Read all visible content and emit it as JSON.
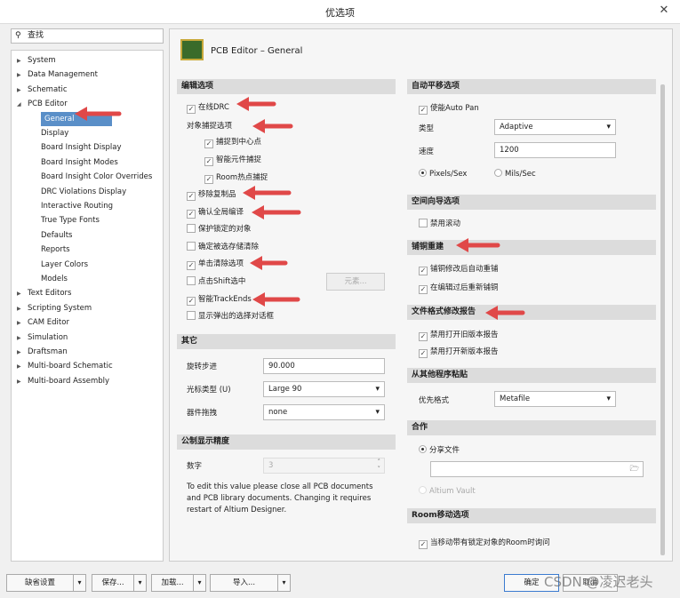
{
  "window": {
    "title": "优选项",
    "close": "✕"
  },
  "search": {
    "placeholder": "查找",
    "icon": "search-icon"
  },
  "tree": [
    {
      "label": "System"
    },
    {
      "label": "Data Management"
    },
    {
      "label": "Schematic"
    },
    {
      "label": "PCB Editor"
    },
    {
      "label": "General"
    },
    {
      "label": "Display"
    },
    {
      "label": "Board Insight Display"
    },
    {
      "label": "Board Insight Modes"
    },
    {
      "label": "Board Insight Color Overrides"
    },
    {
      "label": "DRC Violations Display"
    },
    {
      "label": "Interactive Routing"
    },
    {
      "label": "True Type Fonts"
    },
    {
      "label": "Defaults"
    },
    {
      "label": "Reports"
    },
    {
      "label": "Layer Colors"
    },
    {
      "label": "Models"
    },
    {
      "label": "Text Editors"
    },
    {
      "label": "Scripting System"
    },
    {
      "label": "CAM Editor"
    },
    {
      "label": "Simulation"
    },
    {
      "label": "Draftsman"
    },
    {
      "label": "Multi-board Schematic"
    },
    {
      "label": "Multi-board Assembly"
    }
  ],
  "page_title": "PCB Editor – General",
  "edit": {
    "header": "编辑选项",
    "online_drc": "在线DRC",
    "snap_header": "对象捕捉选项",
    "snap_center": "捕捉到中心点",
    "smart_snap": "智能元件捕捉",
    "room_snap": "Room热点捕捉",
    "remove_dup": "移除复制品",
    "confirm_global": "确认全局编译",
    "protect_locked": "保护锁定的对象",
    "confirm_clear": "确定被选存储清除",
    "click_clear": "单击清除选项",
    "shift_select": "点击Shift选中",
    "elements_btn": "元素...",
    "smart_trackends": "智能TrackEnds",
    "show_popup": "显示弹出的选择对话框"
  },
  "other": {
    "header": "其它",
    "rotation_label": "旋转步进",
    "rotation": "90.000",
    "cursor_label": "光标类型 (U)",
    "cursor": "Large 90",
    "drag_label": "器件拖拽",
    "drag": "none"
  },
  "metric": {
    "header": "公制显示精度",
    "digits_label": "数字",
    "digits": "3",
    "note1": "To edit this value please close all PCB documents",
    "note2": "and PCB library documents. Changing it requires",
    "note3": "restart of Altium Designer."
  },
  "autopan": {
    "header": "自动平移选项",
    "enable": "使能Auto Pan",
    "type_label": "类型",
    "type": "Adaptive",
    "speed_label": "速度",
    "speed": "1200",
    "pixels": "Pixels/Sex",
    "mils": "Mils/Sec"
  },
  "space": {
    "header": "空间向导选项",
    "disable_scroll": "禁用滚动"
  },
  "pour": {
    "header": "铺铜重建",
    "auto": "铺铜修改后自动重铺",
    "after_edit": "在编辑过后重新铺铜"
  },
  "fileformat": {
    "header": "文件格式修改报告",
    "old": "禁用打开旧版本报告",
    "new": "禁用打开新版本报告"
  },
  "paste": {
    "header": "从其他程序粘贴",
    "format_label": "优先格式",
    "format": "Metafile"
  },
  "collab": {
    "header": "合作",
    "share": "分享文件",
    "path": "",
    "vault": "Altium Vault"
  },
  "room": {
    "header": "Room移动选项",
    "locked": "当移动带有锁定对象的Room时询问"
  },
  "footer": {
    "defaults": "缺省设置",
    "save": "保存...",
    "load": "加载...",
    "import": "导入...",
    "ok": "确定",
    "cancel": "取消",
    "watermark": "CSDN @凌迟老头"
  },
  "colors": {
    "accent": "#5a8fc8",
    "arrow": "#e04848"
  }
}
